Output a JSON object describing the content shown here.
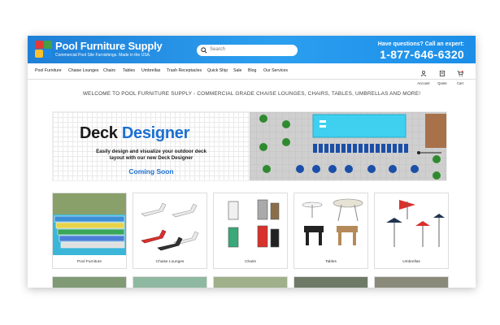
{
  "brand": {
    "title": "Pool Furniture Supply",
    "tagline": "Commercial Pool Site Furnishings. Made in the USA."
  },
  "search": {
    "placeholder": "Search"
  },
  "help": {
    "question": "Have questions? Call an expert:",
    "phone": "1-877-646-6320"
  },
  "nav": {
    "items": [
      "Pool Furniture",
      "Chaise Lounges",
      "Chairs",
      "Tables",
      "Umbrellas",
      "Trash Receptacles",
      "Quick Ship",
      "Sale",
      "Blog",
      "Our Services"
    ],
    "tools": [
      "Account",
      "Quote",
      "Cart"
    ]
  },
  "welcome": "WELCOME TO POOL FURNITURE SUPPLY - COMMERCIAL GRADE CHAISE LOUNGES, CHAIRS, TABLES, UMBRELLAS AND MORE!",
  "banner": {
    "title_part1": "Deck",
    "title_part2": "Designer",
    "line1": "Easily design and visualize your outdoor deck",
    "line2": "layout with our new Deck Designer",
    "cta": "Coming Soon"
  },
  "categories": [
    {
      "name": "Pool Furniture"
    },
    {
      "name": "Chaise Lounges"
    },
    {
      "name": "Chairs"
    },
    {
      "name": "Tables"
    },
    {
      "name": "Umbrellas"
    }
  ],
  "colors": {
    "header_start": "#1f7fd6",
    "header_end": "#2c9ff0",
    "accent_blue": "#1b6fd1",
    "pool": "#3fd0f0"
  }
}
